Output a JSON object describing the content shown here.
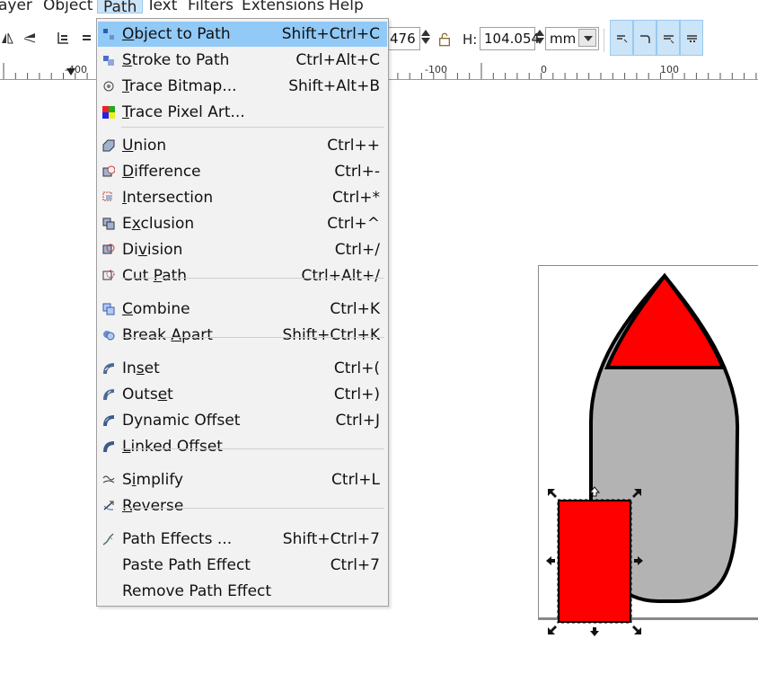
{
  "menubar": {
    "items": [
      "ayer",
      "Object",
      "Path",
      "Text",
      "Filters",
      "Extensions",
      "Help"
    ]
  },
  "toolbar": {
    "w_value_partial": "476",
    "h_label": "H:",
    "h_value": "104.054",
    "unit": "mm"
  },
  "ruler": {
    "labels": [
      "-400",
      "-100",
      "0",
      "100"
    ]
  },
  "path_menu": {
    "items": [
      {
        "label": "Object to Path",
        "shortcut": "Shift+Ctrl+C",
        "icon": "object-to-path-icon"
      },
      {
        "label": "Stroke to Path",
        "shortcut": "Ctrl+Alt+C",
        "icon": "stroke-to-path-icon"
      },
      {
        "label": "Trace Bitmap...",
        "shortcut": "Shift+Alt+B",
        "icon": "trace-bitmap-icon"
      },
      {
        "label": "Trace Pixel Art...",
        "shortcut": "",
        "icon": "trace-pixel-art-icon"
      },
      {
        "label": "Union",
        "shortcut": "Ctrl++",
        "icon": "union-icon"
      },
      {
        "label": "Difference",
        "shortcut": "Ctrl+-",
        "icon": "difference-icon"
      },
      {
        "label": "Intersection",
        "shortcut": "Ctrl+*",
        "icon": "intersection-icon"
      },
      {
        "label": "Exclusion",
        "shortcut": "Ctrl+^",
        "icon": "exclusion-icon"
      },
      {
        "label": "Division",
        "shortcut": "Ctrl+/",
        "icon": "division-icon"
      },
      {
        "label": "Cut Path",
        "shortcut": "Ctrl+Alt+/",
        "icon": "cut-path-icon"
      },
      {
        "label": "Combine",
        "shortcut": "Ctrl+K",
        "icon": "combine-icon"
      },
      {
        "label": "Break Apart",
        "shortcut": "Shift+Ctrl+K",
        "icon": "break-apart-icon"
      },
      {
        "label": "Inset",
        "shortcut": "Ctrl+(",
        "icon": "inset-icon"
      },
      {
        "label": "Outset",
        "shortcut": "Ctrl+)",
        "icon": "outset-icon"
      },
      {
        "label": "Dynamic Offset",
        "shortcut": "Ctrl+J",
        "icon": "dynamic-offset-icon"
      },
      {
        "label": "Linked Offset",
        "shortcut": "",
        "icon": "linked-offset-icon"
      },
      {
        "label": "Simplify",
        "shortcut": "Ctrl+L",
        "icon": "simplify-icon"
      },
      {
        "label": "Reverse",
        "shortcut": "",
        "icon": "reverse-icon"
      },
      {
        "label": "Path Effects ...",
        "shortcut": "Shift+Ctrl+7",
        "icon": "path-effects-icon"
      },
      {
        "label": "Paste Path Effect",
        "shortcut": "Ctrl+7",
        "icon": ""
      },
      {
        "label": "Remove Path Effect",
        "shortcut": "",
        "icon": ""
      }
    ]
  },
  "colors": {
    "highlight": "#91c9f7",
    "menu_bg": "#f2f2f2",
    "shape_red": "#ff0000",
    "shape_gray": "#b3b3b3"
  }
}
